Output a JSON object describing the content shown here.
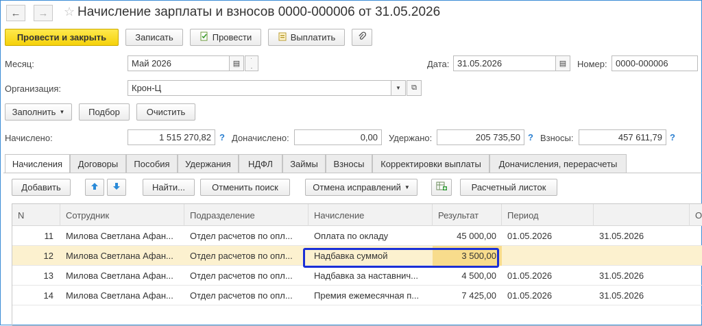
{
  "window": {
    "title": "Начисление зарплаты и взносов 0000-000006 от 31.05.2026"
  },
  "toolbar": {
    "post_close": "Провести и закрыть",
    "save": "Записать",
    "post": "Провести",
    "pay": "Выплатить"
  },
  "form": {
    "month_label": "Месяц:",
    "month_value": "Май 2026",
    "date_label": "Дата:",
    "date_value": "31.05.2026",
    "number_label": "Номер:",
    "number_value": "0000-000006",
    "org_label": "Организация:",
    "org_value": "Крон-Ц"
  },
  "actions": {
    "fill": "Заполнить",
    "pick": "Подбор",
    "clear": "Очистить"
  },
  "totals": {
    "accrued_label": "Начислено:",
    "accrued_value": "1 515 270,82",
    "extra_label": "Доначислено:",
    "extra_value": "0,00",
    "withheld_label": "Удержано:",
    "withheld_value": "205 735,50",
    "contrib_label": "Взносы:",
    "contrib_value": "457 611,79",
    "help": "?"
  },
  "tabs": [
    "Начисления",
    "Договоры",
    "Пособия",
    "Удержания",
    "НДФЛ",
    "Займы",
    "Взносы",
    "Корректировки выплаты",
    "Доначисления, перерасчеты"
  ],
  "table_toolbar": {
    "add": "Добавить",
    "find": "Найти...",
    "cancel_search": "Отменить поиск",
    "cancel_fix": "Отмена исправлений",
    "payslip": "Расчетный листок"
  },
  "table": {
    "columns": [
      "N",
      "Сотрудник",
      "Подразделение",
      "Начисление",
      "Результат",
      "Период",
      "",
      "Ос"
    ],
    "rows": [
      {
        "n": "11",
        "employee": "Милова Светлана Афан...",
        "dept": "Отдел расчетов по опл...",
        "accrual": "Оплата по окладу",
        "result": "45 000,00",
        "from": "01.05.2026",
        "to": "31.05.2026"
      },
      {
        "n": "12",
        "employee": "Милова Светлана Афан...",
        "dept": "Отдел расчетов по опл...",
        "accrual": "Надбавка суммой",
        "result": "3 500,00",
        "from": "",
        "to": ""
      },
      {
        "n": "13",
        "employee": "Милова Светлана Афан...",
        "dept": "Отдел расчетов по опл...",
        "accrual": "Надбавка за наставнич...",
        "result": "4 500,00",
        "from": "01.05.2026",
        "to": "31.05.2026"
      },
      {
        "n": "14",
        "employee": "Милова Светлана Афан...",
        "dept": "Отдел расчетов по опл...",
        "accrual": "Премия ежемесячная п...",
        "result": "7 425,00",
        "from": "01.05.2026",
        "to": "31.05.2026"
      }
    ]
  }
}
